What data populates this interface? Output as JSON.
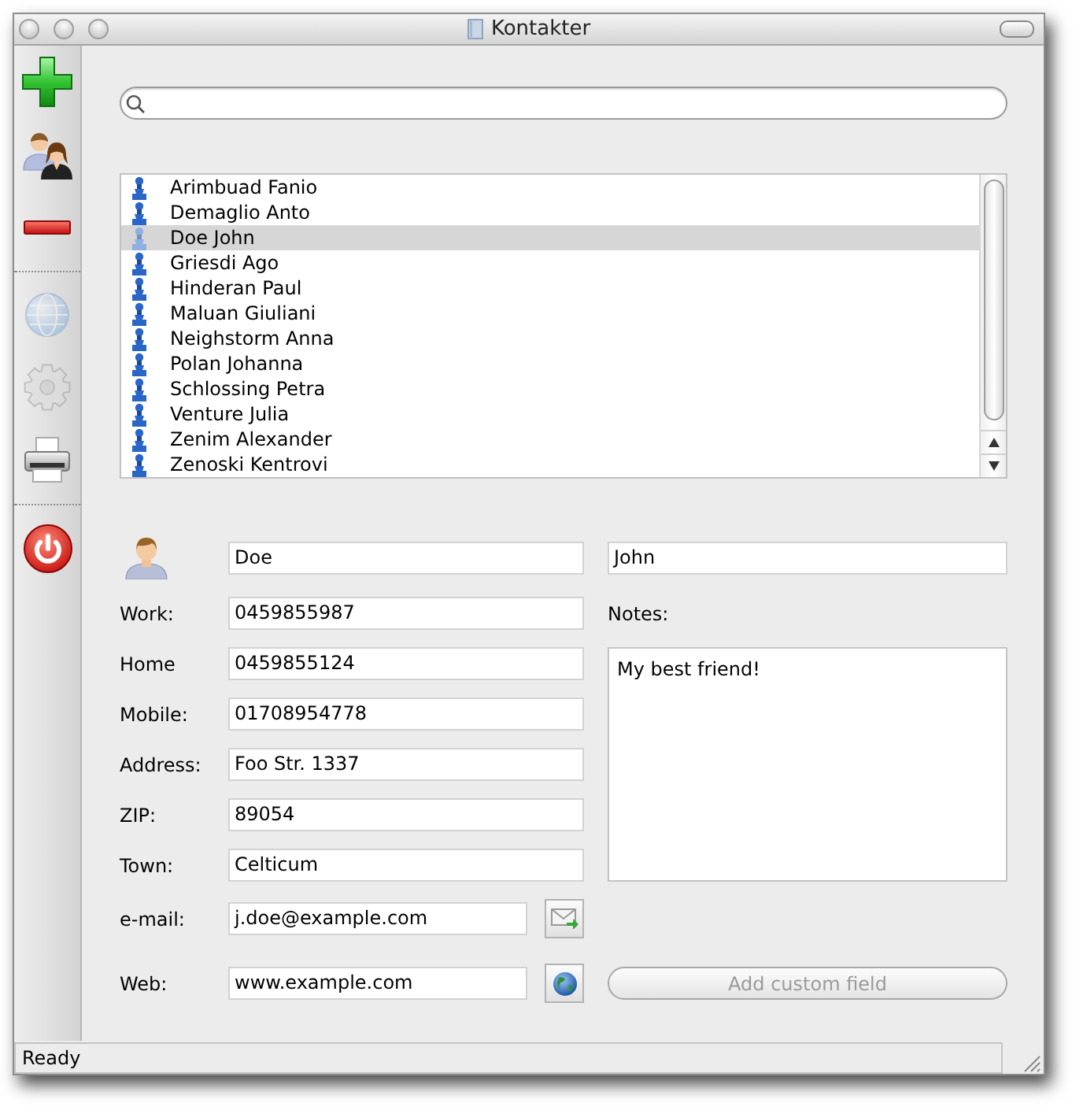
{
  "window": {
    "title": "Kontakter"
  },
  "toolbar": {
    "items": [
      {
        "kind": "add",
        "disabled": false
      },
      {
        "kind": "people",
        "disabled": false
      },
      {
        "kind": "remove",
        "disabled": false
      },
      {
        "kind": "separator"
      },
      {
        "kind": "globe",
        "disabled": true
      },
      {
        "kind": "gear",
        "disabled": true
      },
      {
        "kind": "printer",
        "disabled": false
      },
      {
        "kind": "separator"
      },
      {
        "kind": "power",
        "disabled": false
      }
    ]
  },
  "contacts": [
    {
      "name": "Arimbuad Fanio",
      "selected": false
    },
    {
      "name": "Demaglio Anto",
      "selected": false
    },
    {
      "name": "Doe John",
      "selected": true
    },
    {
      "name": "Griesdi Ago",
      "selected": false
    },
    {
      "name": "Hinderan Paul",
      "selected": false
    },
    {
      "name": "Maluan Giuliani",
      "selected": false
    },
    {
      "name": "Neighstorm Anna",
      "selected": false
    },
    {
      "name": "Polan Johanna",
      "selected": false
    },
    {
      "name": "Schlossing Petra",
      "selected": false
    },
    {
      "name": "Venture Julia",
      "selected": false
    },
    {
      "name": "Zenim Alexander",
      "selected": false
    },
    {
      "name": "Zenoski Kentrovi",
      "selected": false
    }
  ],
  "form": {
    "last_name": "Doe",
    "first_name": "John",
    "fields": [
      {
        "label": "Work:",
        "value": "0459855987",
        "kind": "text"
      },
      {
        "label": "Home",
        "value": "0459855124",
        "kind": "text"
      },
      {
        "label": "Mobile:",
        "value": "01708954778",
        "kind": "text"
      },
      {
        "label": "Address:",
        "value": "Foo Str. 1337",
        "kind": "text"
      },
      {
        "label": "ZIP:",
        "value": "89054",
        "kind": "text"
      },
      {
        "label": "Town:",
        "value": "Celticum",
        "kind": "text"
      },
      {
        "label": "e-mail:",
        "value": "j.doe@example.com",
        "kind": "email"
      },
      {
        "label": "Web:",
        "value": "www.example.com",
        "kind": "web"
      }
    ],
    "notes": {
      "label": "Notes:",
      "value": "My best friend!"
    },
    "add_button": {
      "label": "Add custom field",
      "disabled": true
    }
  },
  "status_bar": {
    "text": "Ready"
  }
}
